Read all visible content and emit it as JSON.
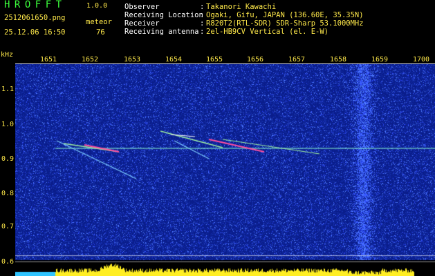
{
  "header": {
    "app_title": "HROFFT",
    "app_version": "1.0.0",
    "file_name": "2512061650.png",
    "detect_label": "meteor",
    "timestamp": "25.12.06 16:50",
    "meteor_count": "76"
  },
  "info": [
    {
      "key": "Observer",
      "value": "Takanori Kawachi"
    },
    {
      "key": "Receiving Location",
      "value": "Ogaki, Gifu, JAPAN (136.60E, 35.35N)"
    },
    {
      "key": "Receiver",
      "value": "R820T2(RTL-SDR) SDR-Sharp 53.1000MHz"
    },
    {
      "key": "Receiving antenna",
      "value": "2el-HB9CV Vertical (el. E-W)"
    }
  ],
  "axis": {
    "y_unit": "kHz",
    "y_ticks": [
      "1.1",
      "1.0",
      "0.9",
      "0.8",
      "0.7",
      "0.6"
    ],
    "x_ticks": [
      "1651",
      "1652",
      "1653",
      "1654",
      "1655",
      "1656",
      "1657",
      "1658",
      "1659",
      "1700"
    ]
  },
  "colors": {
    "background": "#0a1d8c",
    "noise_bright": "#5a78ff",
    "carrier": "#8affd0",
    "echo": "#ff4fa0",
    "power_bar": "#ffee22",
    "power_base": "#2fc4ff"
  }
}
